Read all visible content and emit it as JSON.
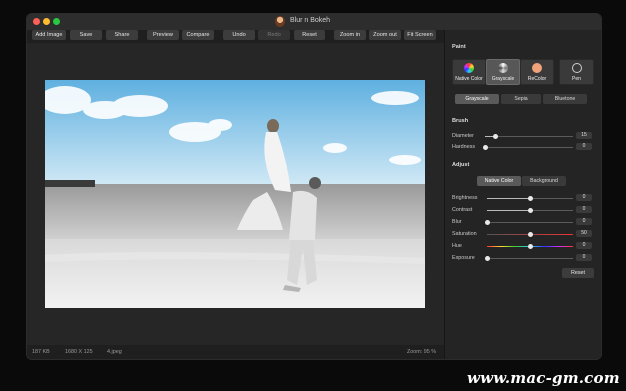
{
  "window": {
    "title": "Blur n Bokeh"
  },
  "toolbar": {
    "add_image": "Add Image",
    "save": "Save",
    "share": "Share",
    "preview": "Preview",
    "compare": "Compare",
    "undo": "Undo",
    "redo": "Redo",
    "reset": "Reset",
    "zoom_in": "Zoom in",
    "zoom_out": "Zoom out",
    "fit_screen": "Fit Screen"
  },
  "status": {
    "file_size": "187 KB",
    "dimensions": "1680 X 125",
    "filename": "4.jpeg",
    "zoom": "Zoom: 95 %"
  },
  "panel": {
    "paint": {
      "title": "Paint",
      "modes": [
        "Native Color",
        "Grayscale",
        "ReColor"
      ],
      "selected_mode": "Grayscale",
      "pen_label": "Pen",
      "tones": [
        "Grayscale",
        "Sepia",
        "Bluetone"
      ],
      "selected_tone": "Grayscale"
    },
    "brush": {
      "title": "Brush",
      "diameter": {
        "label": "Diameter",
        "value": "15",
        "level": 0.12
      },
      "hardness": {
        "label": "Hardness",
        "value": "0",
        "level": 0.0
      }
    },
    "adjust": {
      "title": "Adjust",
      "tabs": [
        "Native Color",
        "Background"
      ],
      "selected_tab": "Native Color",
      "rows": [
        {
          "label": "Brightness",
          "value": "0",
          "level": 0.5
        },
        {
          "label": "Contrast",
          "value": "0",
          "level": 0.5
        },
        {
          "label": "Blur",
          "value": "0",
          "level": 0.0
        },
        {
          "label": "Saturation",
          "value": "50",
          "level": 0.5
        },
        {
          "label": "Hue",
          "value": "0",
          "level": 0.5
        },
        {
          "label": "Exposure",
          "value": "0",
          "level": 0.0
        }
      ],
      "reset": "Reset"
    }
  },
  "watermark": "www.mac-gm.com"
}
